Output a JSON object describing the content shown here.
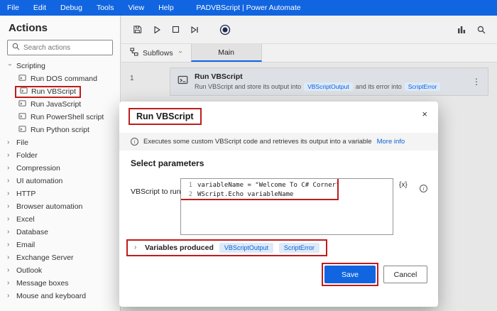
{
  "menubar": {
    "items": [
      "File",
      "Edit",
      "Debug",
      "Tools",
      "View",
      "Help"
    ],
    "title": "PADVBScript | Power Automate"
  },
  "sidebar": {
    "title": "Actions",
    "search_placeholder": "Search actions",
    "scripting_label": "Scripting",
    "scripting_items": [
      "Run DOS command",
      "Run VBScript",
      "Run JavaScript",
      "Run PowerShell script",
      "Run Python script"
    ],
    "collapsed": [
      "File",
      "Folder",
      "Compression",
      "UI automation",
      "HTTP",
      "Browser automation",
      "Excel",
      "Database",
      "Email",
      "Exchange Server",
      "Outlook",
      "Message boxes",
      "Mouse and keyboard"
    ]
  },
  "tabs": {
    "subflows": "Subflows",
    "main": "Main"
  },
  "workspace": {
    "row_number": "1",
    "action": {
      "title": "Run VBScript",
      "desc_part1": "Run VBScript and store its output into",
      "badge1": "VBScriptOutput",
      "desc_part2": "and its error into",
      "badge2": "ScriptError",
      "menu_glyph": "⋮"
    }
  },
  "dialog": {
    "title": "Run VBScript",
    "close_label": "×",
    "info_text": "Executes some custom VBScript code and retrieves its output into a variable",
    "more_info": "More info",
    "section_title": "Select parameters",
    "param_label": "VBScript to run:",
    "code": {
      "l1n": "1",
      "l1": "variableName = \"Welcome To C# Corner\"",
      "l2n": "2",
      "l2": "WScript.Echo variableName"
    },
    "fx_label": "{x}",
    "vars_label": "Variables produced",
    "badges": [
      "VBScriptOutput",
      "ScriptError"
    ],
    "save_label": "Save",
    "cancel_label": "Cancel"
  }
}
